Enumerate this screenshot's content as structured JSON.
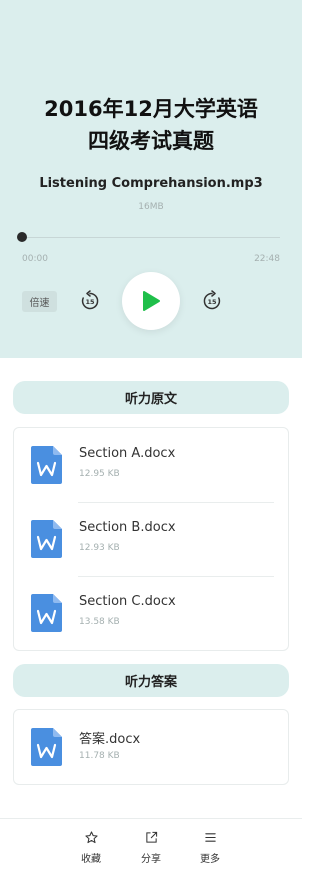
{
  "player": {
    "title_line1": "2016年12月大学英语",
    "title_line2": "四级考试真题",
    "filename": "Listening Comprehansion.mp3",
    "filesize": "16MB",
    "current_time": "00:00",
    "total_time": "22:48",
    "progress": 0,
    "speed_label": "倍速",
    "rewind_seconds": "15",
    "forward_seconds": "15"
  },
  "sections": [
    {
      "title": "听力原文",
      "files": [
        {
          "name": "Section A.docx",
          "size": "12.95 KB",
          "icon": "word-doc-icon"
        },
        {
          "name": "Section B.docx",
          "size": "12.93 KB",
          "icon": "word-doc-icon"
        },
        {
          "name": "Section C.docx",
          "size": "13.58 KB",
          "icon": "word-doc-icon"
        }
      ]
    },
    {
      "title": "听力答案",
      "files": [
        {
          "name": "答案.docx",
          "size": "11.78 KB",
          "icon": "word-doc-icon"
        }
      ]
    }
  ],
  "bottom_bar": {
    "favorite_label": "收藏",
    "share_label": "分享",
    "more_label": "更多"
  },
  "colors": {
    "player_bg": "#dbeeed",
    "play_accent": "#1fbf4a",
    "doc_icon": "#4a8fe0"
  }
}
